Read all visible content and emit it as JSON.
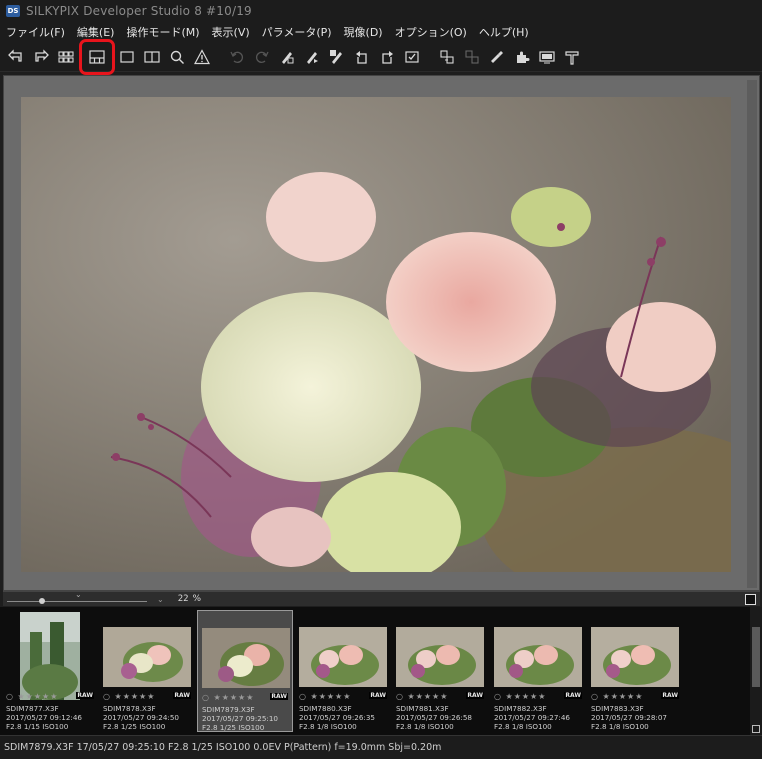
{
  "window": {
    "app_icon": "DS",
    "title": "SILKYPIX Developer Studio 8   #10/19"
  },
  "menu": [
    "ファイル(F)",
    "編集(E)",
    "操作モード(M)",
    "表示(V)",
    "パラメータ(P)",
    "現像(D)",
    "オプション(O)",
    "ヘルプ(H)"
  ],
  "toolbar": {
    "icons": [
      "prev-image-icon",
      "next-image-icon",
      "thumbnail-grid-icon",
      "preview-thumbnail-icon",
      "single-preview-icon",
      "compare-icon",
      "loupe-icon",
      "warning-icon",
      "undo-icon",
      "redo-icon",
      "copy-parameter-icon",
      "paste-parameter-icon",
      "reset-parameter-icon",
      "rotate-left-icon",
      "rotate-right-icon",
      "check-icon",
      "develop-icon",
      "batch-develop-icon",
      "spot-tool-icon",
      "plugin-icon",
      "display-icon",
      "straighten-icon"
    ],
    "highlighted": "preview-thumbnail-icon",
    "highlight_color": "#e8141c"
  },
  "zoom": {
    "value": "22",
    "unit": "%"
  },
  "thumbnails": [
    {
      "name": "SDIM7877.X3F",
      "datetime": "2017/05/27 09:12:46",
      "exposure": "F2.8 1/15 ISO100",
      "stars": "○ ★★★★★",
      "raw": "RAW",
      "selected": false
    },
    {
      "name": "SDIM7878.X3F",
      "datetime": "2017/05/27 09:24:50",
      "exposure": "F2.8 1/25 ISO100",
      "stars": "○ ★★★★★",
      "raw": "RAW",
      "selected": false
    },
    {
      "name": "SDIM7879.X3F",
      "datetime": "2017/05/27 09:25:10",
      "exposure": "F2.8 1/25 ISO100",
      "stars": "○ ★★★★★",
      "raw": "RAW",
      "selected": true
    },
    {
      "name": "SDIM7880.X3F",
      "datetime": "2017/05/27 09:26:35",
      "exposure": "F2.8 1/8 ISO100",
      "stars": "○ ★★★★★",
      "raw": "RAW",
      "selected": false
    },
    {
      "name": "SDIM7881.X3F",
      "datetime": "2017/05/27 09:26:58",
      "exposure": "F2.8 1/8 ISO100",
      "stars": "○ ★★★★★",
      "raw": "RAW",
      "selected": false
    },
    {
      "name": "SDIM7882.X3F",
      "datetime": "2017/05/27 09:27:46",
      "exposure": "F2.8 1/8 ISO100",
      "stars": "○ ★★★★★",
      "raw": "RAW",
      "selected": false
    },
    {
      "name": "SDIM7883.X3F",
      "datetime": "2017/05/27 09:28:07",
      "exposure": "F2.8 1/8 ISO100",
      "stars": "○ ★★★★★",
      "raw": "RAW",
      "selected": false
    }
  ],
  "status": "SDIM7879.X3F 17/05/27 09:25:10 F2.8 1/25 ISO100  0.0EV P(Pattern) f=19.0mm Sbj=0.20m"
}
